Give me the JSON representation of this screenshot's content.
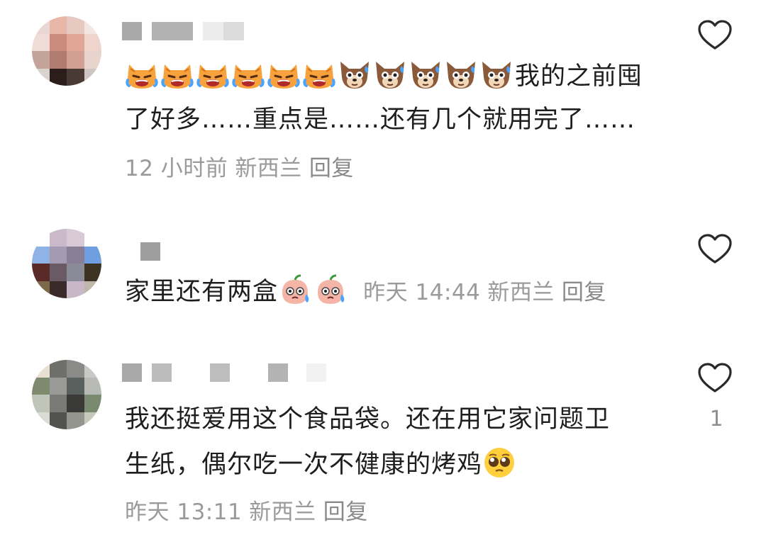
{
  "colors": {
    "text": "#1e1e1e",
    "meta": "#9a9a9a",
    "icon": "#2a2a2a",
    "background": "#ffffff"
  },
  "comments": [
    {
      "line1": "我的之前囤",
      "line2": "了好多……重点是……还有几个就用完了……",
      "emojis": [
        "crying-cat-emoji",
        "crying-cat-emoji",
        "crying-cat-emoji",
        "crying-cat-emoji",
        "crying-cat-emoji",
        "crying-cat-emoji",
        "sweating-dog-emoji",
        "sweating-dog-emoji",
        "sweating-dog-emoji",
        "sweating-dog-emoji",
        "sweating-dog-emoji"
      ],
      "time": "12 小时前",
      "location": "新西兰",
      "reply": "回复"
    },
    {
      "text": "家里还有两盒",
      "emojis": [
        "sweating-peach-emoji",
        "sweating-peach-emoji"
      ],
      "time": "昨天 14:44",
      "location": "新西兰",
      "reply": "回复"
    },
    {
      "line1": "我还挺爱用这个食品袋。还在用它家问题卫",
      "line2": "生纸，偶尔吃一次不健康的烤鸡",
      "emojis": [
        "pleading-face-emoji"
      ],
      "time": "昨天 13:11",
      "location": "新西兰",
      "reply": "回复",
      "likes": "1"
    }
  ]
}
